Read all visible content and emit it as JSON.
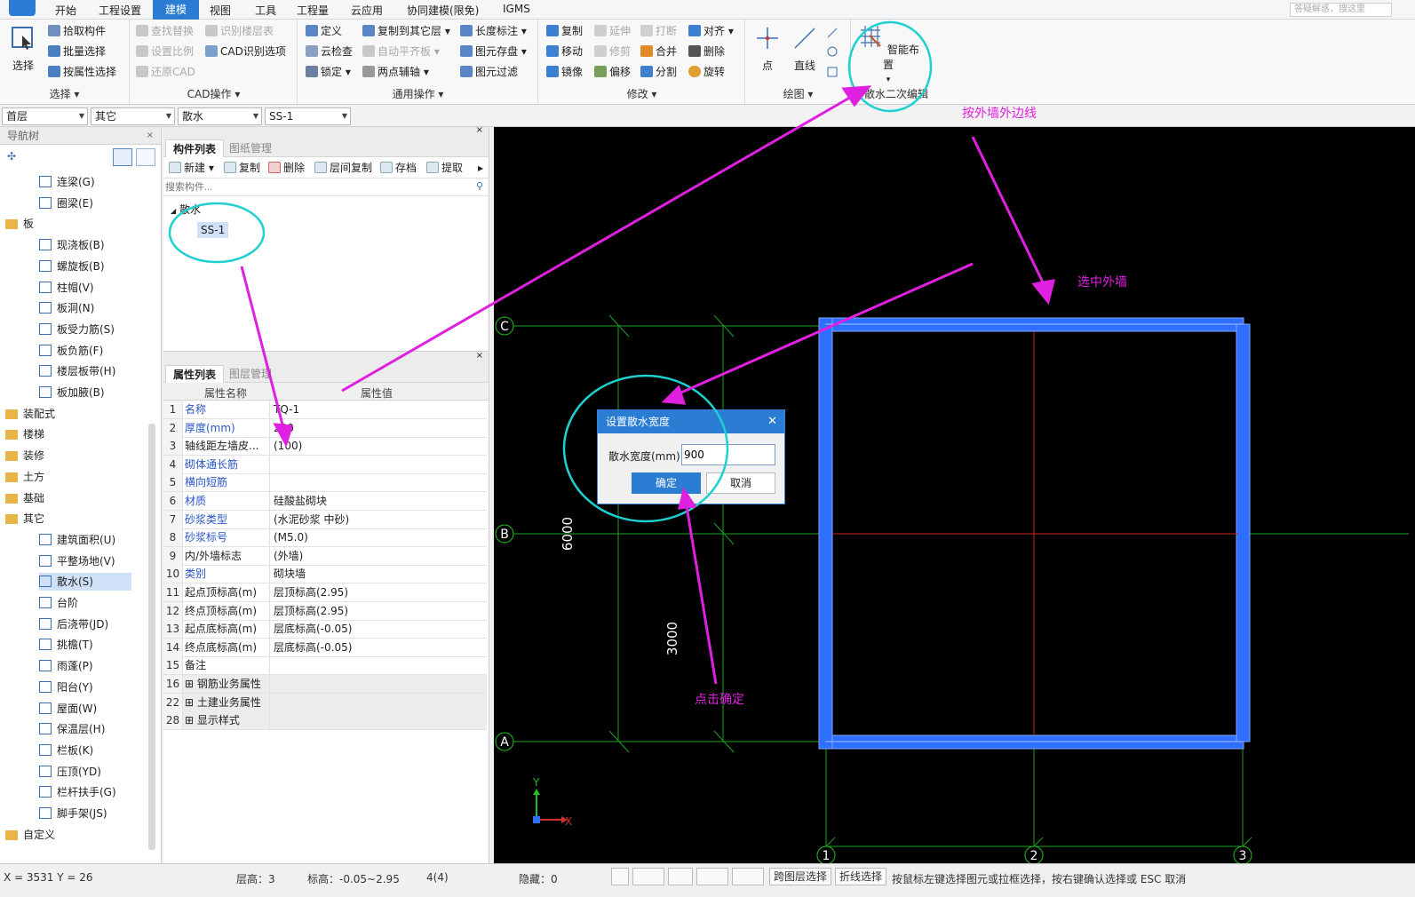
{
  "menu": {
    "items": [
      "开始",
      "工程设置",
      "建模",
      "视图",
      "工具",
      "工程量",
      "云应用",
      "协同建模(限免)",
      "IGMS"
    ],
    "active": "建模",
    "search_placeholder": "答疑解惑，搜这里"
  },
  "ribbon": {
    "select_group": {
      "big": "选择",
      "items": [
        "拾取构件",
        "批量选择",
        "按属性选择"
      ],
      "title": "选择"
    },
    "cad_group": {
      "items": [
        "查找替换",
        "识别楼层表",
        "CAD识别选项",
        "设置比例",
        "还原CAD"
      ],
      "title": "CAD操作"
    },
    "common_group": {
      "items": [
        "定义",
        "复制到其它层",
        "长度标注",
        "云检查",
        "自动平齐板",
        "图元存盘",
        "锁定",
        "两点辅轴",
        "图元过滤"
      ],
      "title": "通用操作"
    },
    "modify_group": {
      "items": [
        "复制",
        "延伸",
        "打断",
        "对齐",
        "移动",
        "修剪",
        "合并",
        "删除",
        "镜像",
        "偏移",
        "分割",
        "旋转"
      ],
      "title": "修改"
    },
    "draw_group": {
      "items": [
        "点",
        "直线"
      ],
      "title": "绘图"
    },
    "smart_group": {
      "big": "智能布置",
      "title": "散水二次编辑"
    }
  },
  "selectors": [
    "首层",
    "其它",
    "散水",
    "SS-1"
  ],
  "nav": {
    "title": "导航树",
    "items": [
      {
        "label": "连梁(G)",
        "type": "leaf"
      },
      {
        "label": "圈梁(E)",
        "type": "leaf"
      },
      {
        "label": "板",
        "type": "folder"
      },
      {
        "label": "现浇板(B)",
        "type": "leaf"
      },
      {
        "label": "螺旋板(B)",
        "type": "leaf"
      },
      {
        "label": "柱帽(V)",
        "type": "leaf"
      },
      {
        "label": "板洞(N)",
        "type": "leaf"
      },
      {
        "label": "板受力筋(S)",
        "type": "leaf"
      },
      {
        "label": "板负筋(F)",
        "type": "leaf"
      },
      {
        "label": "楼层板带(H)",
        "type": "leaf"
      },
      {
        "label": "板加腋(B)",
        "type": "leaf"
      },
      {
        "label": "装配式",
        "type": "folder"
      },
      {
        "label": "楼梯",
        "type": "folder"
      },
      {
        "label": "装修",
        "type": "folder"
      },
      {
        "label": "土方",
        "type": "folder"
      },
      {
        "label": "基础",
        "type": "folder"
      },
      {
        "label": "其它",
        "type": "folder"
      },
      {
        "label": "建筑面积(U)",
        "type": "leaf"
      },
      {
        "label": "平整场地(V)",
        "type": "leaf"
      },
      {
        "label": "散水(S)",
        "type": "leaf",
        "selected": true
      },
      {
        "label": "台阶",
        "type": "leaf"
      },
      {
        "label": "后浇带(JD)",
        "type": "leaf"
      },
      {
        "label": "挑檐(T)",
        "type": "leaf"
      },
      {
        "label": "雨蓬(P)",
        "type": "leaf"
      },
      {
        "label": "阳台(Y)",
        "type": "leaf"
      },
      {
        "label": "屋面(W)",
        "type": "leaf"
      },
      {
        "label": "保温层(H)",
        "type": "leaf"
      },
      {
        "label": "栏板(K)",
        "type": "leaf"
      },
      {
        "label": "压顶(YD)",
        "type": "leaf"
      },
      {
        "label": "栏杆扶手(G)",
        "type": "leaf"
      },
      {
        "label": "脚手架(JS)",
        "type": "leaf"
      },
      {
        "label": "自定义",
        "type": "folder"
      }
    ]
  },
  "components": {
    "tabs": [
      "构件列表",
      "图纸管理"
    ],
    "toolbar": [
      "新建",
      "复制",
      "删除",
      "层间复制",
      "存档",
      "提取"
    ],
    "search_placeholder": "搜索构件...",
    "tree_root": "散水",
    "tree_item": "SS-1"
  },
  "properties": {
    "tabs": [
      "属性列表",
      "图层管理"
    ],
    "headers": [
      "属性名称",
      "属性值"
    ],
    "rows": [
      {
        "n": "1",
        "name": "名称",
        "value": "TQ-1",
        "blue": true
      },
      {
        "n": "2",
        "name": "厚度(mm)",
        "value": "200",
        "blue": true
      },
      {
        "n": "3",
        "name": "轴线距左墙皮...",
        "value": "(100)",
        "blue": false
      },
      {
        "n": "4",
        "name": "砌体通长筋",
        "value": "",
        "blue": true
      },
      {
        "n": "5",
        "name": "横向短筋",
        "value": "",
        "blue": true
      },
      {
        "n": "6",
        "name": "材质",
        "value": "硅酸盐砌块",
        "blue": true
      },
      {
        "n": "7",
        "name": "砂浆类型",
        "value": "(水泥砂浆 中砂)",
        "blue": true
      },
      {
        "n": "8",
        "name": "砂浆标号",
        "value": "(M5.0)",
        "blue": true
      },
      {
        "n": "9",
        "name": "内/外墙标志",
        "value": "(外墙)",
        "blue": false
      },
      {
        "n": "10",
        "name": "类别",
        "value": "砌块墙",
        "blue": true
      },
      {
        "n": "11",
        "name": "起点顶标高(m)",
        "value": "层顶标高(2.95)",
        "blue": false
      },
      {
        "n": "12",
        "name": "终点顶标高(m)",
        "value": "层顶标高(2.95)",
        "blue": false
      },
      {
        "n": "13",
        "name": "起点底标高(m)",
        "value": "层底标高(-0.05)",
        "blue": false
      },
      {
        "n": "14",
        "name": "终点底标高(m)",
        "value": "层底标高(-0.05)",
        "blue": false
      },
      {
        "n": "15",
        "name": "备注",
        "value": "",
        "blue": false
      },
      {
        "n": "16",
        "name": "钢筋业务属性",
        "value": "",
        "group": true
      },
      {
        "n": "22",
        "name": "土建业务属性",
        "value": "",
        "group": true
      },
      {
        "n": "28",
        "name": "显示样式",
        "value": "",
        "group": true
      }
    ]
  },
  "canvas": {
    "axis_rows": [
      "C",
      "B",
      "A"
    ],
    "axis_cols": [
      "1",
      "2",
      "3"
    ],
    "dim_6000": "6000",
    "dim_3000": "3000",
    "axis_x": "X",
    "axis_y": "Y"
  },
  "dialog": {
    "title": "设置散水宽度",
    "label": "散水宽度(mm)",
    "value": "900",
    "ok": "确定",
    "cancel": "取消"
  },
  "annotations": {
    "outer_line": "按外墙外边线",
    "select_wall": "选中外墙",
    "click_ok": "点击确定"
  },
  "status": {
    "coords": "X = 3531 Y = 26",
    "floor_height": "层高：3",
    "elevation": "标高：-0.05~2.95",
    "count": "4(4)",
    "hidden": "隐藏：0",
    "cross_floor": "跨图层选择",
    "polyline": "折线选择",
    "hint": "按鼠标左键选择图元或拉框选择，按右键确认选择或 ESC 取消"
  },
  "colors": {
    "accent": "#2b7cd3",
    "annotation": "#e020e0",
    "wall": "#2f6fff",
    "grid": "#1fa01f",
    "cyan_circle": "#20d0d0"
  }
}
